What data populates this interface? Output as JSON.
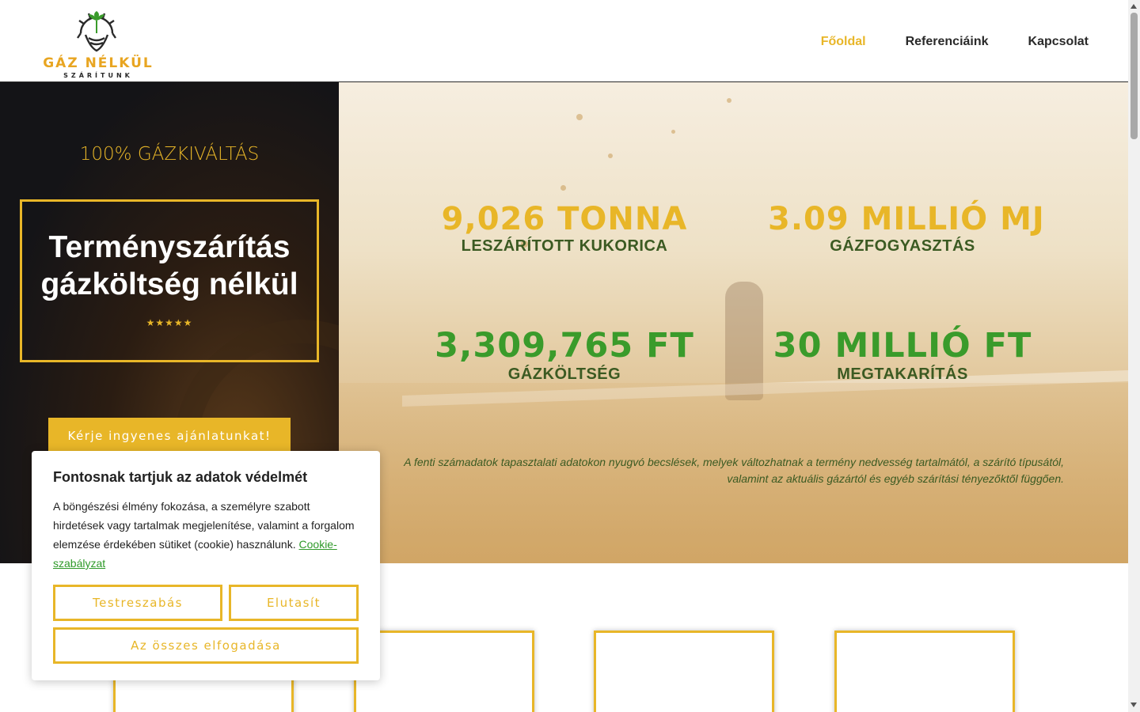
{
  "brand": {
    "name": "GÁZ NÉLKÜL",
    "tagline": "SZÁRÍTUNK",
    "accent": "#e8b628",
    "green": "#3a9b2b",
    "dark_green": "#3b5a22"
  },
  "nav": {
    "items": [
      {
        "label": "Főoldal",
        "active": true
      },
      {
        "label": "Referenciáink",
        "active": false
      },
      {
        "label": "Kapcsolat",
        "active": false
      }
    ]
  },
  "hero": {
    "kicker": "100% GÁZKIVÁLTÁS",
    "title": "Terményszárítás gázköltség nélkül",
    "rating": "★★★★★",
    "cta": "Kérje ingyenes ajánlatunkat!"
  },
  "stats": [
    {
      "value": "9,026 TONNA",
      "label": "LESZÁRÍTOTT KUKORICA"
    },
    {
      "value": "3.09 MILLIÓ MJ",
      "label": "GÁZFOGYASZTÁS"
    },
    {
      "value": "3,309,765 FT",
      "label": "GÁZKÖLTSÉG"
    },
    {
      "value": "30 MILLIÓ FT",
      "label": "MEGTAKARÍTÁS"
    }
  ],
  "disclaimer": "A fenti számadatok tapasztalati adatokon nyugvó becslések, melyek változhatnak a termény nedvesség tartalmától, a szárító típusától, valamint az aktuális gázártól és egyéb szárítási tényezőktől függően.",
  "cookie": {
    "title": "Fontosnak tartjuk az adatok védelmét",
    "body": "A böngészési élmény fokozása, a személyre szabott hirdetések vagy tartalmak megjelenítése, valamint a forgalom elemzése érdekében sütiket (cookie) használunk.",
    "link": "Cookie-szabályzat",
    "customize": "Testreszabás",
    "reject": "Elutasít",
    "accept_all": "Az összes elfogadása"
  }
}
